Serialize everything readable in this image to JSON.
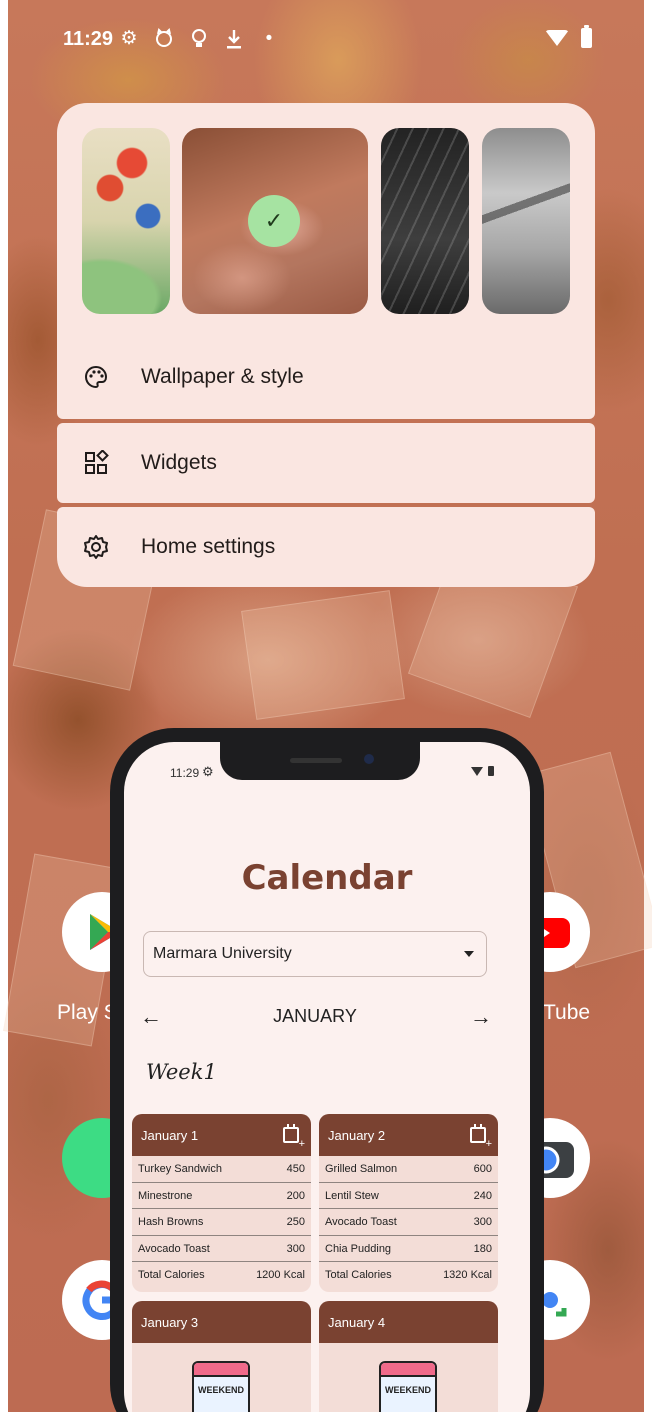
{
  "status_bar": {
    "time": "11:29",
    "left_icons": [
      "gear-icon",
      "cat-icon",
      "lightbulb-icon",
      "download-icon",
      "dot-icon"
    ],
    "right_icons": [
      "wifi-icon",
      "battery-icon"
    ]
  },
  "wallpaper_picker": {
    "thumbnails": [
      {
        "name": "flowers-wallpaper",
        "selected": false
      },
      {
        "name": "crystals-wallpaper",
        "selected": true
      },
      {
        "name": "dark-structure-wallpaper",
        "selected": false
      },
      {
        "name": "grey-structure-wallpaper",
        "selected": false
      }
    ],
    "check_glyph": "✓"
  },
  "menu": {
    "wallpaper_style": "Wallpaper & style",
    "widgets": "Widgets",
    "home_settings": "Home settings"
  },
  "home_apps": {
    "left_label": "Play S",
    "right_label": "Tube"
  },
  "inner_app": {
    "status_time": "11:29",
    "title": "Calendar",
    "university_select": "Marmara University",
    "month": "JANUARY",
    "week": "Week1",
    "days": [
      {
        "date": "January 1",
        "meals": [
          {
            "name": "Turkey Sandwich",
            "cal": "450"
          },
          {
            "name": "Minestrone",
            "cal": "200"
          },
          {
            "name": "Hash Browns",
            "cal": "250"
          },
          {
            "name": "Avocado Toast",
            "cal": "300"
          }
        ],
        "total_label": "Total Calories",
        "total": "1200 Kcal"
      },
      {
        "date": "January 2",
        "meals": [
          {
            "name": "Grilled Salmon",
            "cal": "600"
          },
          {
            "name": "Lentil Stew",
            "cal": "240"
          },
          {
            "name": "Avocado Toast",
            "cal": "300"
          },
          {
            "name": "Chia Pudding",
            "cal": "180"
          }
        ],
        "total_label": "Total Calories",
        "total": "1320 Kcal"
      },
      {
        "date": "January 3",
        "weekend_label": "WEEKEND"
      },
      {
        "date": "January 4",
        "weekend_label": "WEEKEND"
      }
    ]
  },
  "colors": {
    "accent_brown": "#7a4231",
    "popup_bg": "#fae6e1",
    "card_bg": "#f3ddd7",
    "screen_bg": "#fcf1ef",
    "selected_check": "#a6e3a2"
  }
}
